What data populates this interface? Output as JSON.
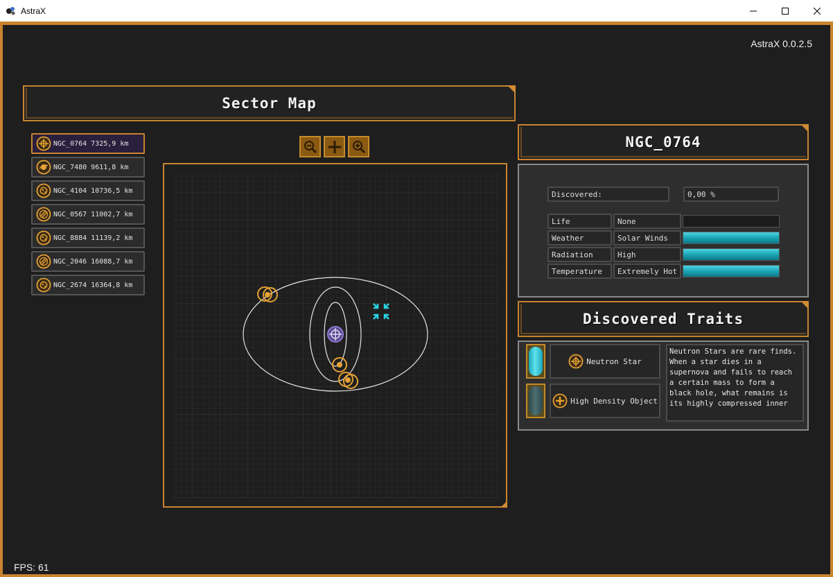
{
  "window": {
    "title": "AstraX",
    "minimize_glyph": "—",
    "maximize_glyph": "☐",
    "close_glyph": "✕"
  },
  "version": "AstraX 0.0.2.5",
  "fps": "FPS: 61",
  "sector_map": {
    "title": "Sector Map",
    "targets": [
      {
        "label": "NGC_0764 7325,9 km",
        "icon": "neutron-star-icon",
        "selected": true
      },
      {
        "label": "NGC_7480 9611,8 km",
        "icon": "planet-icon",
        "selected": false
      },
      {
        "label": "NGC_4104 10736,5 km",
        "icon": "asteroid-icon",
        "selected": false
      },
      {
        "label": "NGC_0567 11002,7 km",
        "icon": "gas-giant-icon",
        "selected": false
      },
      {
        "label": "NGC_8884 11139,2 km",
        "icon": "asteroid-icon",
        "selected": false
      },
      {
        "label": "NGC_2046 16088,7 km",
        "icon": "gas-giant-icon",
        "selected": false
      },
      {
        "label": "NGC_2674 16364,8 km",
        "icon": "asteroid-icon",
        "selected": false
      }
    ],
    "zoom_buttons": [
      "zoom-out-icon",
      "center-icon",
      "zoom-in-icon"
    ]
  },
  "object": {
    "name": "NGC_0764",
    "discovered_label": "Discovered:",
    "discovered_value": "0,00 %",
    "stats": [
      {
        "label": "Life",
        "value": "None",
        "level": 0
      },
      {
        "label": "Weather",
        "value": "Solar Winds",
        "level": 1
      },
      {
        "label": "Radiation",
        "value": "High",
        "level": 1
      },
      {
        "label": "Temperature",
        "value": "Extremely Hot",
        "level": 1
      }
    ]
  },
  "traits": {
    "title": "Discovered Traits",
    "items": [
      {
        "label": "Neutron Star",
        "icon": "neutron-star-icon",
        "active": true
      },
      {
        "label": "High Density Object",
        "icon": "plus-icon",
        "active": false
      }
    ],
    "description": "Neutron Stars are rare finds.  When a star dies in a supernova and fails to reach a certain mass to form a black hole, what remains is its highly compressed inner"
  },
  "colors": {
    "accent": "#c9832f",
    "cyan": "#2ad4e4",
    "orbit": "#e8e8e8",
    "selected": "#8f7ad8"
  }
}
